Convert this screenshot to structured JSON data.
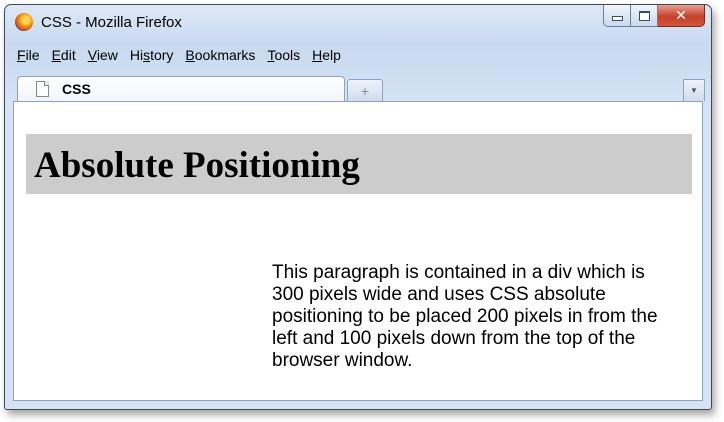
{
  "window": {
    "title": "CSS - Mozilla Firefox",
    "app_icon": "firefox-logo",
    "controls": {
      "minimize_icon": "minimize-icon",
      "maximize_icon": "maximize-icon",
      "close_icon": "close-icon",
      "close_glyph": "✕"
    }
  },
  "menubar": {
    "items": [
      {
        "accel": "F",
        "rest": "ile"
      },
      {
        "accel": "E",
        "rest": "dit"
      },
      {
        "accel": "V",
        "rest": "iew"
      },
      {
        "pre": "Hi",
        "accel": "s",
        "rest": "tory"
      },
      {
        "accel": "B",
        "rest": "ookmarks"
      },
      {
        "accel": "T",
        "rest": "ools"
      },
      {
        "accel": "H",
        "rest": "elp"
      }
    ]
  },
  "tabs": {
    "active": {
      "label": "CSS",
      "icon": "page-icon"
    },
    "new_tab_glyph": "+",
    "list_all_glyph": "▼"
  },
  "page": {
    "heading": "Absolute Positioning",
    "paragraph": "This paragraph is contained in a div which is 300 pixels wide and uses CSS absolute positioning to be placed 200 pixels in from the left and 100 pixels down from the top of the browser window.",
    "heading_bg": "#cccccc"
  }
}
